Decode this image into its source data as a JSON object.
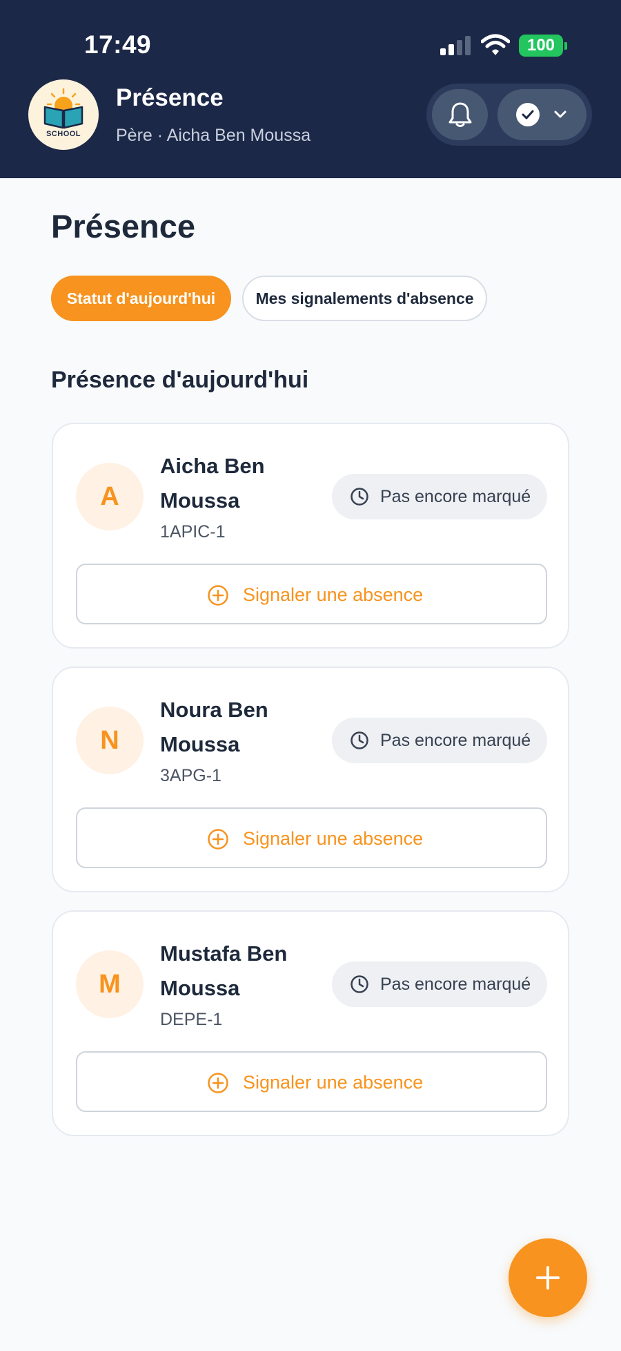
{
  "status_bar": {
    "time": "17:49",
    "battery": "100"
  },
  "header": {
    "logo_text": "SCHOOL",
    "title": "Présence",
    "subtitle": "Père · Aicha Ben Moussa",
    "icons": {
      "notifications": "bell-icon",
      "status": "check-circle-icon",
      "dropdown": "chevron-down-icon"
    }
  },
  "page": {
    "title": "Présence",
    "tabs": [
      {
        "label": "Statut d'aujourd'hui",
        "active": true
      },
      {
        "label": "Mes signalements d'absence",
        "active": false
      }
    ],
    "section_title": "Présence d'aujourd'hui"
  },
  "students": [
    {
      "initial": "A",
      "name": "Aicha Ben Moussa",
      "class": "1APIC-1",
      "status": "Pas encore marqué",
      "action": "Signaler une absence"
    },
    {
      "initial": "N",
      "name": "Noura Ben Moussa",
      "class": "3APG-1",
      "status": "Pas encore marqué",
      "action": "Signaler une absence"
    },
    {
      "initial": "M",
      "name": "Mustafa Ben Moussa",
      "class": "DEPE-1",
      "status": "Pas encore marqué",
      "action": "Signaler une absence"
    }
  ],
  "colors": {
    "header_bg": "#1c2847",
    "accent": "#f7931e",
    "page_bg": "#f8fafc",
    "battery": "#22c55e"
  },
  "fab": {
    "icon": "plus-icon"
  }
}
